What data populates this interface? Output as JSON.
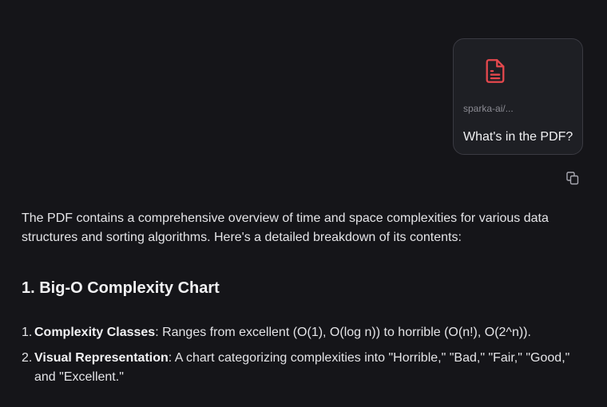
{
  "attachment": {
    "file_name": "sparka-ai/...",
    "icon": "pdf-file-icon",
    "icon_color": "#e5484d"
  },
  "user_message": {
    "text": "What's in the PDF?"
  },
  "actions": {
    "copy_icon": "copy-icon"
  },
  "assistant": {
    "intro": "The PDF contains a comprehensive overview of time and space complexities for various data structures and sorting algorithms. Here's a detailed breakdown of its contents:",
    "heading": "1. Big-O Complexity Chart",
    "items": [
      {
        "number": "1.",
        "title": "Complexity Classes",
        "text": ": Ranges from excellent (O(1), O(log n)) to horrible (O(n!), O(2^n))."
      },
      {
        "number": "2.",
        "title": "Visual Representation",
        "text": ": A chart categorizing complexities into \"Horrible,\" \"Bad,\" \"Fair,\" \"Good,\" and \"Excellent.\""
      }
    ]
  }
}
